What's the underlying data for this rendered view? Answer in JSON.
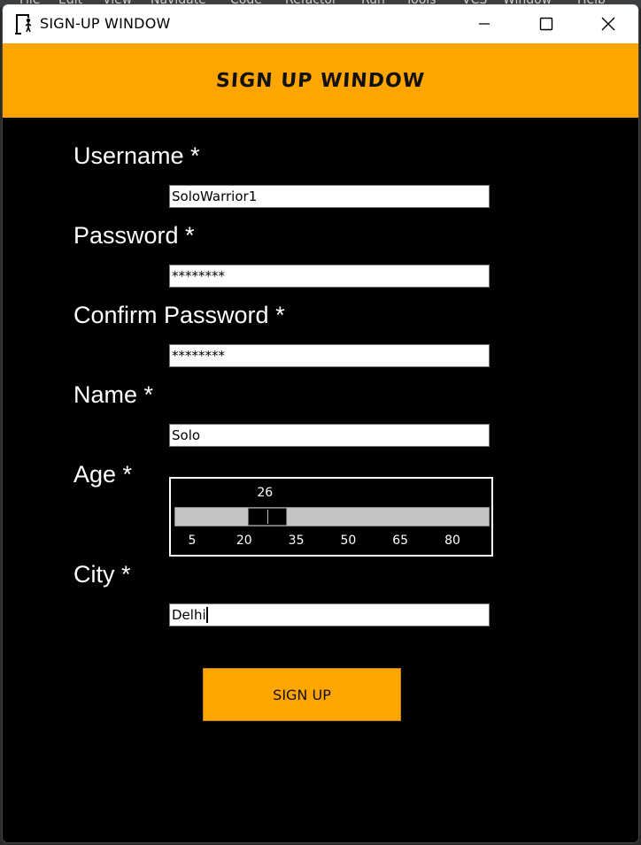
{
  "ide_menu": [
    "File",
    "Edit",
    "View",
    "Navigate",
    "Code",
    "Refactor",
    "Run",
    "Tools",
    "VCS",
    "Window",
    "Help"
  ],
  "window": {
    "title": "SIGN-UP WINDOW",
    "icon": "hangman-feather-icon"
  },
  "banner": {
    "text": "SIGN UP WINDOW",
    "color": "#ffa500"
  },
  "form": {
    "username": {
      "label": "Username *",
      "value": "SoloWarrior1"
    },
    "password": {
      "label": "Password *",
      "value": "********"
    },
    "confirm_password": {
      "label": "Confirm Password *",
      "value": "********"
    },
    "name": {
      "label": "Name *",
      "value": "Solo"
    },
    "age": {
      "label": "Age *",
      "value": "26",
      "value_num": 26,
      "min": 5,
      "max": 95,
      "ticks": [
        "5",
        "20",
        "35",
        "50",
        "65",
        "80"
      ]
    },
    "city": {
      "label": "City *",
      "value": "Delhi"
    }
  },
  "signup_button": {
    "label": "SIGN UP"
  }
}
